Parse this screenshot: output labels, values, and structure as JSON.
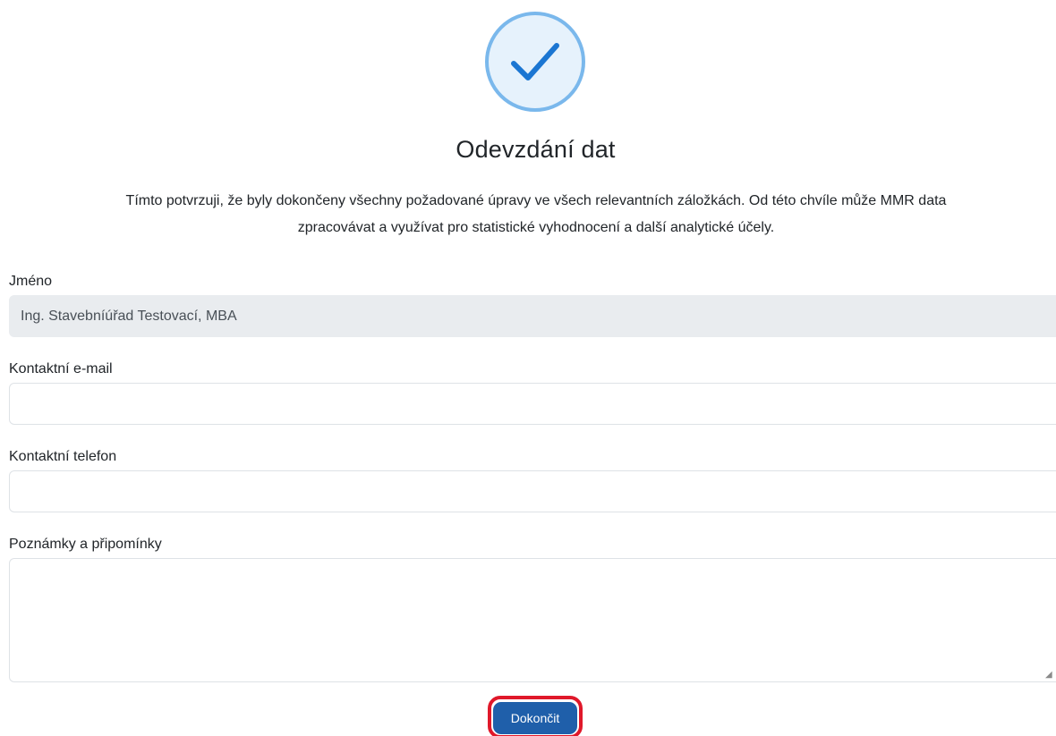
{
  "icons": {
    "success": "check-icon"
  },
  "colors": {
    "accent": "#1f5faa",
    "check": "#1b76d2",
    "highlight": "#e0182a"
  },
  "title": "Odevzdání dat",
  "intro": {
    "line1": "Tímto potvrzuji, že byly dokončeny všechny požadované úpravy ve všech relevantních záložkách. Od této chvíle může MMR data",
    "line2": "zpracovávat a využívat pro statistické vyhodnocení a další analytické účely."
  },
  "form": {
    "name": {
      "label": "Jméno",
      "value": "Ing. Stavebníúřad Testovací, MBA"
    },
    "email": {
      "label": "Kontaktní e-mail",
      "value": ""
    },
    "phone": {
      "label": "Kontaktní telefon",
      "value": ""
    },
    "notes": {
      "label": "Poznámky a připomínky",
      "value": ""
    }
  },
  "submit_label": "Dokončit"
}
